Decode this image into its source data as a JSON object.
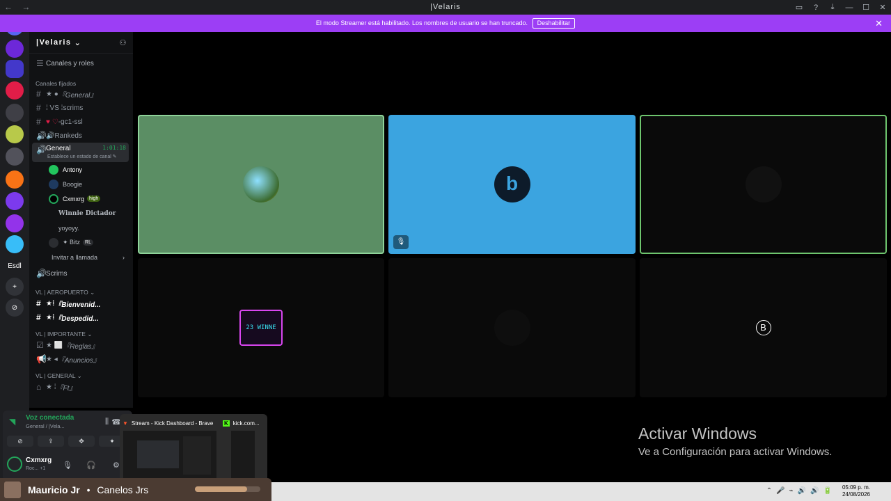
{
  "window": {
    "title": "|Velaris",
    "nav_back": "←",
    "nav_forward": "→",
    "controls": [
      "▭",
      "?",
      "⤓",
      "—",
      "☐",
      "✕"
    ]
  },
  "banner": {
    "text": "El modo Streamer está habilitado. Los nombres de usuario se han truncado.",
    "button": "Deshabilitar",
    "close": "✕"
  },
  "servers": [
    {
      "label": "",
      "color": "#5865f2",
      "icon": "discord-icon"
    },
    {
      "label": "",
      "color": "#d946ef"
    },
    {
      "label": "",
      "color": "#4f46e5"
    },
    {
      "label": "",
      "color": "#e11d48"
    },
    {
      "label": "",
      "color": "#444"
    },
    {
      "label": "",
      "color": "#b8c94a"
    },
    {
      "label": "",
      "color": "#666"
    },
    {
      "label": "",
      "color": "#f97316"
    },
    {
      "label": "",
      "color": "#7c3aed"
    },
    {
      "label": "",
      "color": "#9333ea"
    },
    {
      "label": "",
      "color": "#38bdf8"
    },
    {
      "label": "Esdl",
      "color": "#1e1f22"
    },
    {
      "label": "+",
      "color": "#313338"
    },
    {
      "label": "⊘",
      "color": "#313338"
    }
  ],
  "server": {
    "name": "|Velaris",
    "chevron": "⌄",
    "invite_icon": "person-plus-icon"
  },
  "channels": {
    "roles": "Canales y roles",
    "pinned_label": "Canales fijados",
    "pinned": [
      {
        "prefix": "★ ● ",
        "name": "『General』"
      },
      {
        "prefix": "⁞ VS ⁞ ",
        "name": "scrims"
      },
      {
        "prefix": "♥ ♡ ",
        "name": "-gc1-ssl"
      },
      {
        "prefix": "🔊 ",
        "name": "Rankeds"
      }
    ],
    "active": {
      "name": "General",
      "time": "1:01:18",
      "status": "Establece un estado de canal ✎"
    },
    "users": [
      {
        "name": "Antony",
        "badge": ""
      },
      {
        "name": "Boogie",
        "badge": ""
      },
      {
        "name": "Cxmxrg",
        "badge": "high"
      },
      {
        "name": "Winnie Dictador",
        "badge": ""
      },
      {
        "name": "yoyoyy.",
        "badge": ""
      },
      {
        "name": "✦ Bitz",
        "badge": "RL"
      }
    ],
    "invite": "Invitar a llamada",
    "scrims": "Scrims",
    "cat_aeropuerto": "VL | AEROPUERTO ⌄",
    "aeropuerto": [
      {
        "prefix": "★⁞ ",
        "name": "『Bienvenid..."
      },
      {
        "prefix": "★⁞ ",
        "name": "『Despedid..."
      }
    ],
    "cat_importante": "VL | IMPORTANTE ⌄",
    "importante": [
      {
        "prefix": "★ ⬜ ",
        "name": "『Reglas』"
      },
      {
        "prefix": "★ ◂ ",
        "name": "『Anuncios』"
      }
    ],
    "cat_general": "VL | GENERAL ⌄",
    "general": [
      {
        "prefix": "★ ⁞ ",
        "name": "『Ft』"
      }
    ]
  },
  "voice": {
    "status": "Voz conectada",
    "where": "General / |Vela...",
    "buttons": [
      "⊘",
      "⇪",
      "✥",
      "✦"
    ],
    "user": "Cxmxrg",
    "user_status": "Roc... +1"
  },
  "tiles": [
    {
      "color": "#5b8e64",
      "border": "#8fd49a"
    },
    {
      "color": "#3ba4e0",
      "border": "#3ba4e0"
    },
    {
      "color": "#0a0a0a",
      "border": "#6ec56e"
    },
    {
      "color": "#0a0a0a",
      "border": "#0a0a0a"
    },
    {
      "color": "#0a0a0a",
      "border": "#0a0a0a"
    },
    {
      "color": "#0a0a0a",
      "border": "#0a0a0a"
    }
  ],
  "tile_icons": {
    "logo2": "b",
    "logo6": "B"
  },
  "activate": {
    "line1": "Activar Windows",
    "line2": "Ve a Configuración para activar Windows."
  },
  "preview": {
    "item1": "Stream - Kick Dashboard - Brave",
    "item2": "kick.com..."
  },
  "nowplaying": {
    "artist": "Mauricio Jr",
    "sep": "•",
    "title": "Canelos Jrs",
    "progress": 0.8
  },
  "taskbar": {
    "time": "05:09 p. m.",
    "date": "24/08/2026",
    "tray": [
      "⌃",
      "🎤",
      "⌁",
      "🔊",
      "🔊",
      "🔋"
    ]
  }
}
